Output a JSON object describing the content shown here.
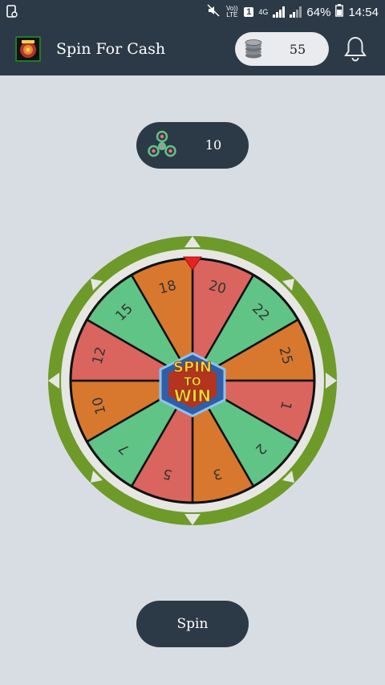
{
  "status_bar": {
    "network_label": "Vo)) LTE",
    "sim": "1",
    "network_type": "4G",
    "battery": "64%",
    "time": "14:54"
  },
  "app_bar": {
    "title": "Spin For Cash",
    "coins": "55",
    "icons": [
      "app-logo",
      "coin-stack-icon",
      "bell-icon"
    ]
  },
  "spins": {
    "count": "10",
    "icon": "fidget-spinner-icon"
  },
  "wheel": {
    "segments": [
      {
        "label": "20",
        "color": "#d9655e"
      },
      {
        "label": "22",
        "color": "#5fc486"
      },
      {
        "label": "25",
        "color": "#d8782e"
      },
      {
        "label": "1",
        "color": "#d9655e"
      },
      {
        "label": "2",
        "color": "#5fc486"
      },
      {
        "label": "3",
        "color": "#d8782e"
      },
      {
        "label": "5",
        "color": "#d9655e"
      },
      {
        "label": "7",
        "color": "#5fc486"
      },
      {
        "label": "10",
        "color": "#d8782e"
      },
      {
        "label": "12",
        "color": "#d9655e"
      },
      {
        "label": "15",
        "color": "#5fc486"
      },
      {
        "label": "18",
        "color": "#d8782e"
      }
    ],
    "center_line_1": "SPIN",
    "center_line_2": "TO",
    "center_line_3": "WIN",
    "rim_color": "#6e9a2a",
    "pointer_color": "#e8231f"
  },
  "spin_button": {
    "label": "Spin"
  }
}
